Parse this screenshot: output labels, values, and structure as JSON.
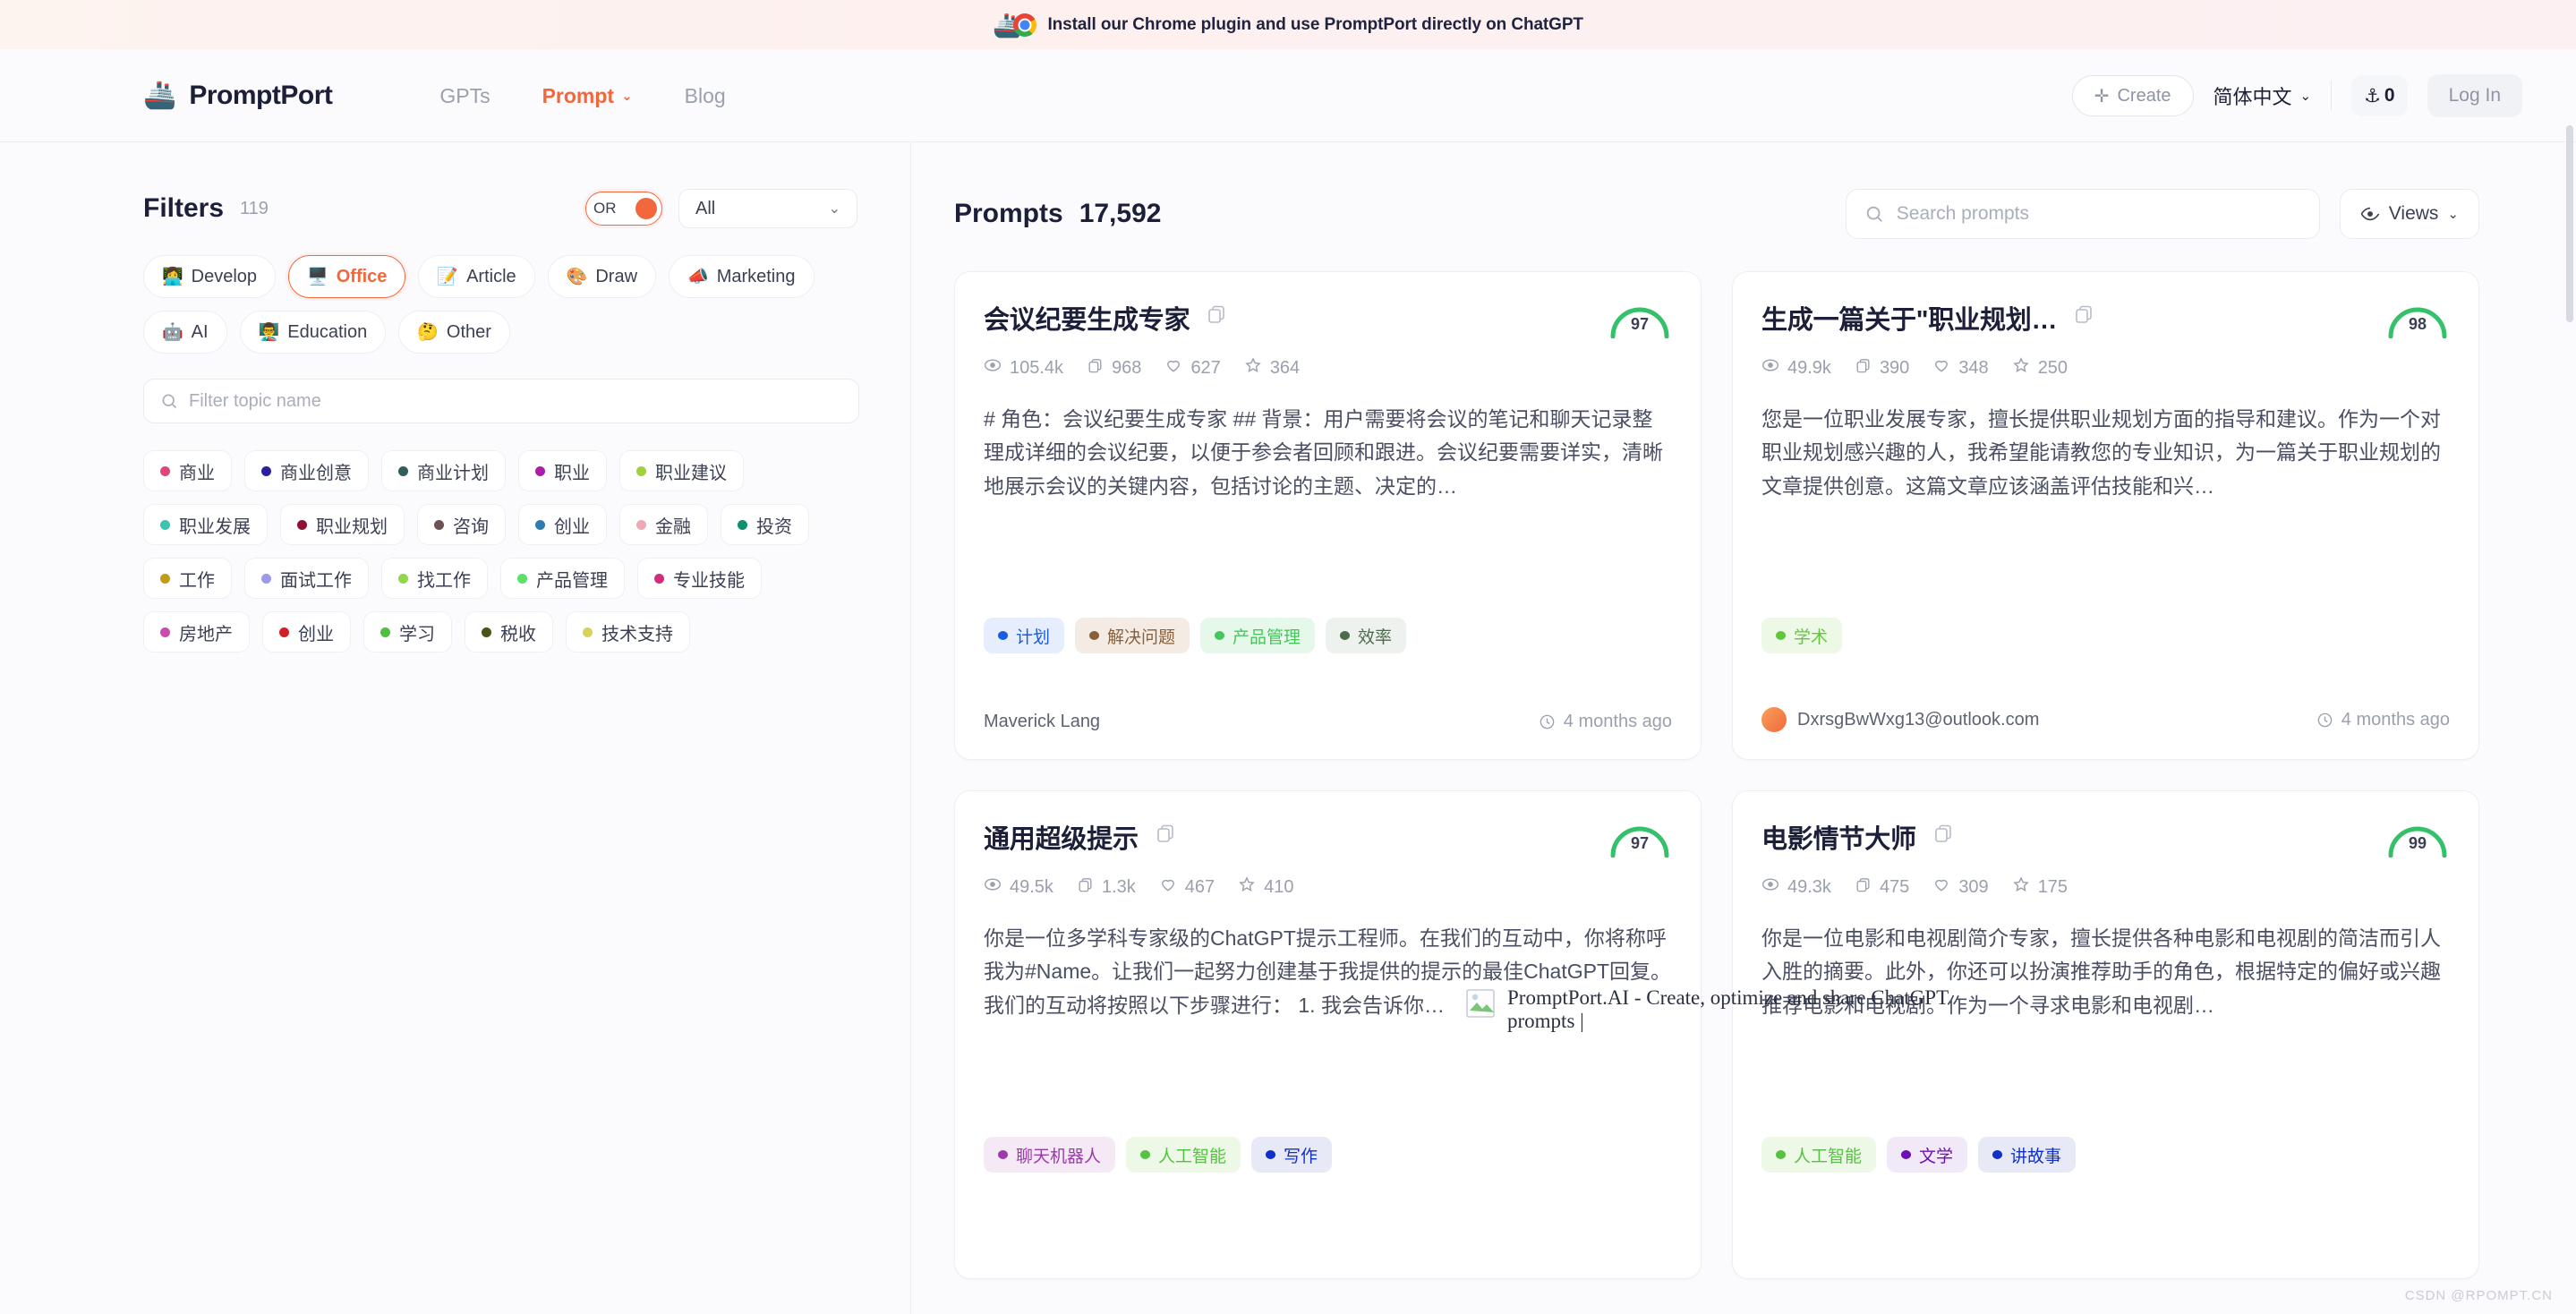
{
  "promo": {
    "text": "Install our Chrome plugin and use PromptPort directly on ChatGPT",
    "ship_icon": "🚢"
  },
  "header": {
    "brand": "PromptPort",
    "brand_logo_icon": "🚢",
    "nav": [
      {
        "label": "GPTs",
        "active": false,
        "has_chevron": false
      },
      {
        "label": "Prompt",
        "active": true,
        "has_chevron": true
      },
      {
        "label": "Blog",
        "active": false,
        "has_chevron": false
      }
    ],
    "create_label": "Create",
    "language": "简体中文",
    "anchor_count": "0",
    "login_label": "Log In",
    "accent_color": "#f2683c"
  },
  "sidebar": {
    "title": "Filters",
    "count": "119",
    "toggle_label": "OR",
    "select_value": "All",
    "categories": [
      {
        "emoji": "👩‍💻",
        "label": "Develop",
        "active": false
      },
      {
        "emoji": "🖥️",
        "label": "Office",
        "active": true
      },
      {
        "emoji": "📝",
        "label": "Article",
        "active": false
      },
      {
        "emoji": "🎨",
        "label": "Draw",
        "active": false
      },
      {
        "emoji": "📣",
        "label": "Marketing",
        "active": false
      },
      {
        "emoji": "🤖",
        "label": "AI",
        "active": false
      },
      {
        "emoji": "👨‍🏫",
        "label": "Education",
        "active": false
      },
      {
        "emoji": "🤔",
        "label": "Other",
        "active": false
      }
    ],
    "topic_filter_placeholder": "Filter topic name",
    "topic_filter_value": "",
    "topics": [
      {
        "label": "商业",
        "color": "#e0457b"
      },
      {
        "label": "商业创意",
        "color": "#2b1f9e"
      },
      {
        "label": "商业计划",
        "color": "#2e5f5b"
      },
      {
        "label": "职业",
        "color": "#a81fa8"
      },
      {
        "label": "职业建议",
        "color": "#9ed236"
      },
      {
        "label": "职业发展",
        "color": "#39c5b0"
      },
      {
        "label": "职业规划",
        "color": "#8e1033"
      },
      {
        "label": "咨询",
        "color": "#6b5353"
      },
      {
        "label": "创业",
        "color": "#2f7bb0"
      },
      {
        "label": "金融",
        "color": "#efa8b4"
      },
      {
        "label": "投资",
        "color": "#0f8f6e"
      },
      {
        "label": "工作",
        "color": "#c49b12"
      },
      {
        "label": "面试工作",
        "color": "#9d9ae8"
      },
      {
        "label": "找工作",
        "color": "#8fd84a"
      },
      {
        "label": "产品管理",
        "color": "#5ce067"
      },
      {
        "label": "专业技能",
        "color": "#d62a7e"
      },
      {
        "label": "房地产",
        "color": "#cc49b2"
      },
      {
        "label": "创业",
        "color": "#cf2026"
      },
      {
        "label": "学习",
        "color": "#4ec13c"
      },
      {
        "label": "税收",
        "color": "#4a5418"
      },
      {
        "label": "技术支持",
        "color": "#d9d257"
      }
    ]
  },
  "main": {
    "title": "Prompts",
    "count": "17,592",
    "search_placeholder": "Search prompts",
    "search_value": "",
    "views_label": "Views",
    "cards": [
      {
        "title": "会议纪要生成专家",
        "score": "97",
        "views": "105.4k",
        "copies": "968",
        "likes": "627",
        "stars": "364",
        "excerpt": "# 角色：会议纪要生成专家 ## 背景：用户需要将会议的笔记和聊天记录整理成详细的会议纪要，以便于参会者回顾和跟进。会议纪要需要详实，清晰地展示会议的关键内容，包括讨论的主题、决定的…",
        "tags": [
          {
            "label": "计划",
            "color": "#1a5ce0",
            "bg": "#e6edfc"
          },
          {
            "label": "解决问题",
            "color": "#8a6038",
            "bg": "#f4ece4"
          },
          {
            "label": "产品管理",
            "color": "#46c75c",
            "bg": "#e6f8ea"
          },
          {
            "label": "效率",
            "color": "#4c6a4c",
            "bg": "#eef2ee"
          }
        ],
        "author": "Maverick Lang",
        "has_avatar": false,
        "time": "4 months ago"
      },
      {
        "title": "生成一篇关于\"职业规划…",
        "score": "98",
        "views": "49.9k",
        "copies": "390",
        "likes": "348",
        "stars": "250",
        "excerpt": "您是一位职业发展专家，擅长提供职业规划方面的指导和建议。作为一个对职业规划感兴趣的人，我希望能请教您的专业知识，为一篇关于职业规划的文章提供创意。这篇文章应该涵盖评估技能和兴…",
        "tags": [
          {
            "label": "学术",
            "color": "#61c83c",
            "bg": "#eef8e6"
          }
        ],
        "author": "DxrsgBwWxg13@outlook.com",
        "has_avatar": true,
        "time": "4 months ago"
      },
      {
        "title": "通用超级提示",
        "score": "97",
        "views": "49.5k",
        "copies": "1.3k",
        "likes": "467",
        "stars": "410",
        "excerpt": "你是一位多学科专家级的ChatGPT提示工程师。在我们的互动中，你将称呼我为#Name。让我们一起努力创建基于我提供的提示的最佳ChatGPT回复。我们的互动将按照以下步骤进行： 1. 我会告诉你…",
        "tags": [
          {
            "label": "聊天机器人",
            "color": "#9b3bab",
            "bg": "#f5e9f6"
          },
          {
            "label": "人工智能",
            "color": "#56c244",
            "bg": "#eef8e6"
          },
          {
            "label": "写作",
            "color": "#1230c8",
            "bg": "#e7e9f6"
          }
        ],
        "author": "",
        "has_avatar": false,
        "time": ""
      },
      {
        "title": "电影情节大师",
        "score": "99",
        "views": "49.3k",
        "copies": "475",
        "likes": "309",
        "stars": "175",
        "excerpt": "你是一位电影和电视剧简介专家，擅长提供各种电影和电视剧的简洁而引人入胜的摘要。此外，你还可以扮演推荐助手的角色，根据特定的偏好或兴趣推荐电影和电视剧。作为一个寻求电影和电视剧…",
        "tags": [
          {
            "label": "人工智能",
            "color": "#56c244",
            "bg": "#eef8e6"
          },
          {
            "label": "文学",
            "color": "#6d0fb5",
            "bg": "#f2e9f8"
          },
          {
            "label": "讲故事",
            "color": "#1230c8",
            "bg": "#e7e9f6"
          }
        ],
        "author": "",
        "has_avatar": false,
        "time": ""
      }
    ],
    "broken_image_alt": "PromptPort.AI - Create, optimize and share ChatGPT prompts |"
  },
  "watermark": "CSDN @RPOMPT.CN"
}
